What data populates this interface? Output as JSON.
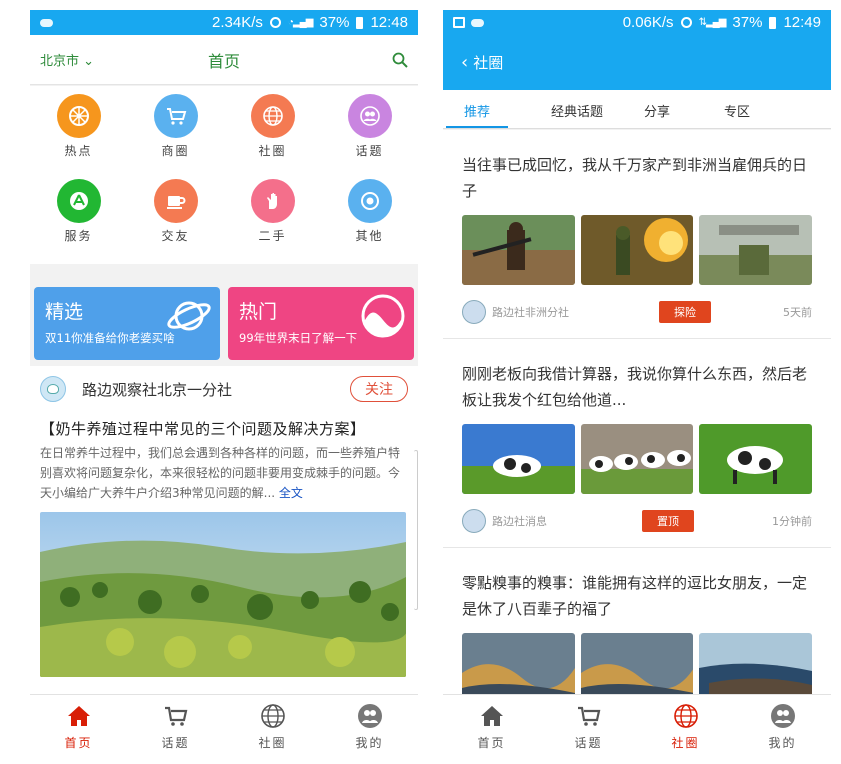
{
  "left": {
    "status": {
      "speed": "2.34K/s",
      "battery": "37%",
      "time": "12:48"
    },
    "nav": {
      "city": "北京市",
      "title": "首页"
    },
    "grid": [
      {
        "label": "热点",
        "icon": "hot-icon",
        "color": "#f6961d"
      },
      {
        "label": "商圈",
        "icon": "cart-icon",
        "color": "#5ab1ef"
      },
      {
        "label": "社圈",
        "icon": "globe-icon",
        "color": "#f47a52"
      },
      {
        "label": "话题",
        "icon": "people-icon",
        "color": "#c985e0"
      },
      {
        "label": "服务",
        "icon": "app-store-icon",
        "color": "#22b733"
      },
      {
        "label": "交友",
        "icon": "cup-icon",
        "color": "#f47a52"
      },
      {
        "label": "二手",
        "icon": "hand-icon",
        "color": "#f46f8b"
      },
      {
        "label": "其他",
        "icon": "target-icon",
        "color": "#5ab1ef"
      }
    ],
    "banners": [
      {
        "title": "精选",
        "subtitle": "双11你准备给你老婆买啥",
        "color": "#4fa0ea"
      },
      {
        "title": "热门",
        "subtitle": "99年世界末日了解一下",
        "color": "#ef4583"
      }
    ],
    "post": {
      "author": "路边观察社北京一分社",
      "follow": "关注",
      "title": "【奶牛养殖过程中常见的三个问题及解决方案】",
      "body": "在日常养牛过程中，我们总会遇到各种各样的问题，而一些养殖户特别喜欢将问题复杂化，本来很轻松的问题非要用变成棘手的问题。今天小编给广大养牛户介绍3种常见问题的解...",
      "more": "全文"
    },
    "tabs": [
      {
        "label": "首页",
        "icon": "home-icon"
      },
      {
        "label": "话题",
        "icon": "cart-icon"
      },
      {
        "label": "社圈",
        "icon": "globe-icon"
      },
      {
        "label": "我的",
        "icon": "user-icon"
      }
    ]
  },
  "right": {
    "status": {
      "speed": "0.06K/s",
      "battery": "37%",
      "time": "12:49"
    },
    "nav": {
      "title": "社圈"
    },
    "tabs": [
      "推荐",
      "经典话题",
      "分享",
      "专区"
    ],
    "feed": [
      {
        "title": "当往事已成回忆，我从千万家产到非洲当雇佣兵的日子",
        "source": "路边社非洲分社",
        "tag": "探险",
        "time": "5天前"
      },
      {
        "title": "刚刚老板向我借计算器，我说你算什么东西，然后老板让我发个红包给他道...",
        "source": "路边社消息",
        "tag": "置顶",
        "time": "1分钟前"
      },
      {
        "title": "零點糗事的糗事：谁能拥有这样的逗比女朋友，一定是休了八百辈子的福了",
        "source": "",
        "tag": "",
        "time": ""
      }
    ],
    "bottom": [
      {
        "label": "首页",
        "icon": "home-icon"
      },
      {
        "label": "话题",
        "icon": "cart-icon"
      },
      {
        "label": "社圈",
        "icon": "globe-icon"
      },
      {
        "label": "我的",
        "icon": "user-icon"
      }
    ]
  },
  "colors": {
    "accent_blue": "#18a8f0",
    "green_title": "#2e8b3a",
    "tab_active": "#d81e06",
    "tag_red": "#e0451e"
  }
}
